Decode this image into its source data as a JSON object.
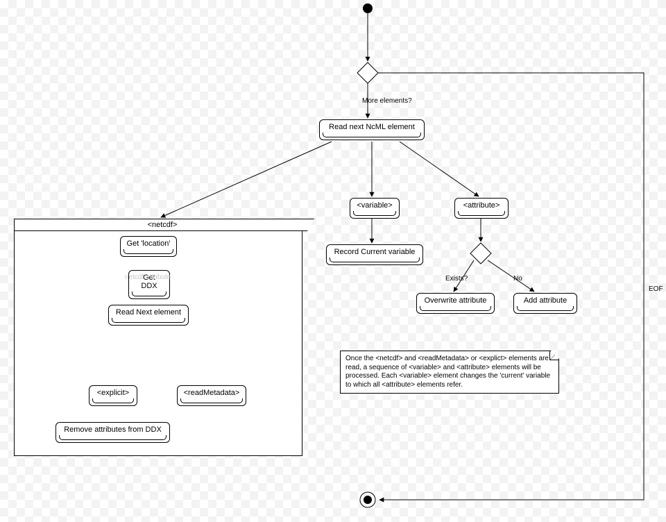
{
  "nodes": {
    "start": "",
    "decision_top": "",
    "read_next_ncml": "Read next NcML element",
    "variable": "<variable>",
    "record_current_variable": "Record Current variable",
    "attribute": "<attribute>",
    "decision_exists": "",
    "overwrite_attribute": "Overwrite attribute",
    "add_attribute": "Add attribute",
    "final": ""
  },
  "netcdf_frame": {
    "title": "<netcdf>",
    "get_location": "Get 'location'",
    "get_ddx": "Get DDX",
    "read_next_element": "Read Next element",
    "decision": "",
    "explicit": "<explicit>",
    "read_metadata": "<readMetadata>",
    "remove_attrs": "Remove attributes from DDX"
  },
  "edge_labels": {
    "more_elements": "More elements?",
    "eof": "EOF",
    "exists": "Exists?",
    "no": "No"
  },
  "faded_label": "netcdf attribute",
  "note_text": "Once the <netcdf> and <readMetadata> or <explict> elements are read, a sequence of <variable> and <attribute> elements will be processed. Each <variable> element changes the 'current' variable to which all <attribute> elements refer."
}
